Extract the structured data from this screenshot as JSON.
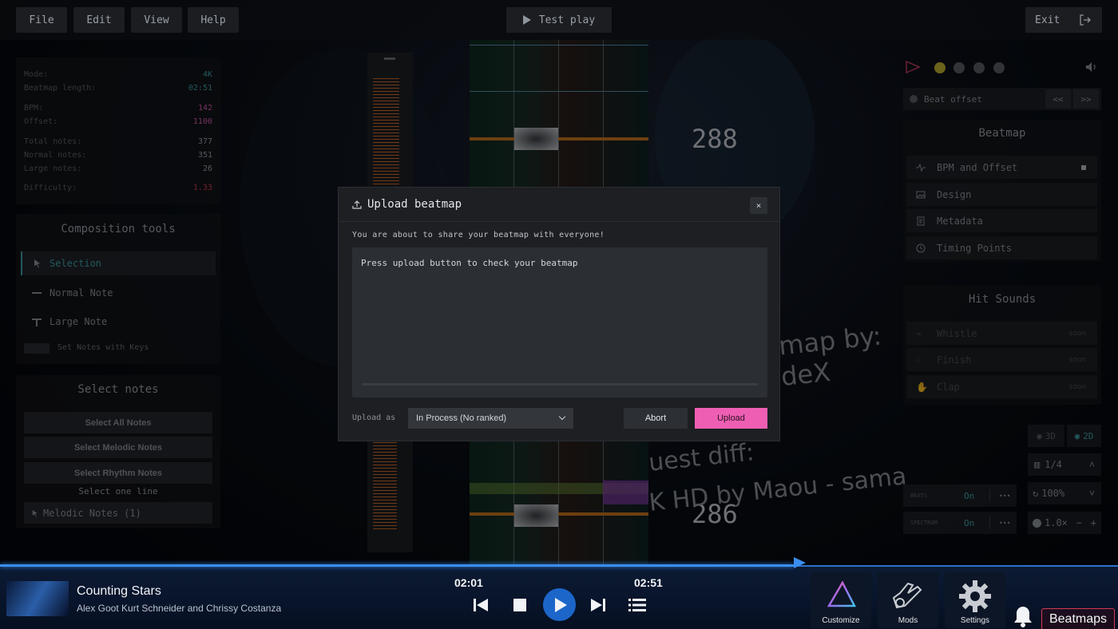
{
  "menu": {
    "file": "File",
    "edit": "Edit",
    "view": "View",
    "help": "Help",
    "test_play": "Test play",
    "exit": "Exit"
  },
  "stats": {
    "mode_label": "Mode:",
    "mode": "4K",
    "length_label": "Beatmap length:",
    "length": "02:51",
    "bpm_label": "BPM:",
    "bpm": "142",
    "offset_label": "Offset:",
    "offset": "1100",
    "total_label": "Total notes:",
    "total": "377",
    "normal_label": "Normal notes:",
    "normal": "351",
    "large_label": "Large notes:",
    "large": "26",
    "difficulty_label": "Difficulty:",
    "difficulty": "1.33"
  },
  "composition": {
    "title": "Composition tools",
    "selection": "Selection",
    "normal_note": "Normal Note",
    "large_note": "Large Note",
    "set_notes_keys": "Set Notes with Keys"
  },
  "select_notes": {
    "title": "Select notes",
    "all": "Select All Notes",
    "melodic": "Select Melodic Notes",
    "rhythm": "Select Rhythm Notes",
    "one_line": "Select one line",
    "dropdown": "Melodic Notes (1)"
  },
  "editor": {
    "count_top": "288",
    "count_bottom": "286",
    "bg_text_1": "map by:",
    "bg_text_2": "deX",
    "bg_text_3": "uest diff:",
    "bg_text_4": "K HD by Maou - sama"
  },
  "right_panel": {
    "beat_offset": "Beat offset",
    "prev": "<<",
    "next": ">>",
    "beatmap_title": "Beatmap",
    "bpm_offset": "BPM and Offset",
    "design": "Design",
    "metadata": "Metadata",
    "timing_points": "Timing Points",
    "hit_sounds_title": "Hit Sounds",
    "whistle": "Whistle",
    "finish": "Finish",
    "clap": "Clap",
    "soon": "soon",
    "view_3d": "3D",
    "view_2d": "2D",
    "snap": "1/4",
    "beats_label": "BEATS",
    "beats_state": "On",
    "spectrum_label": "SPECTRUM",
    "spectrum_state": "On",
    "speed": "100%",
    "rate": "1.0×",
    "more": "•••"
  },
  "modal": {
    "title": "Upload beatmap",
    "close": "×",
    "message": "You are about to share your beatmap with everyone!",
    "box_text": "Press upload button to check your beatmap",
    "upload_as_label": "Upload as",
    "upload_as_value": "In Process (No ranked)",
    "abort": "Abort",
    "upload": "Upload"
  },
  "player": {
    "title": "Counting Stars",
    "artist": "Alex Goot Kurt Schneider and Chrissy Costanza",
    "current_time": "02:01",
    "total_time": "02:51",
    "progress": 0.71
  },
  "nav": {
    "customize": "Customize",
    "mods": "Mods",
    "settings": "Settings",
    "beatmaps": "Beatmaps"
  },
  "colors": {
    "accent_pink": "#ee5fb3",
    "accent_blue": "#1c66c9",
    "bpm_pink": "#d45bb0",
    "offset_red": "#d23a55",
    "teal": "#3fa3a8"
  }
}
